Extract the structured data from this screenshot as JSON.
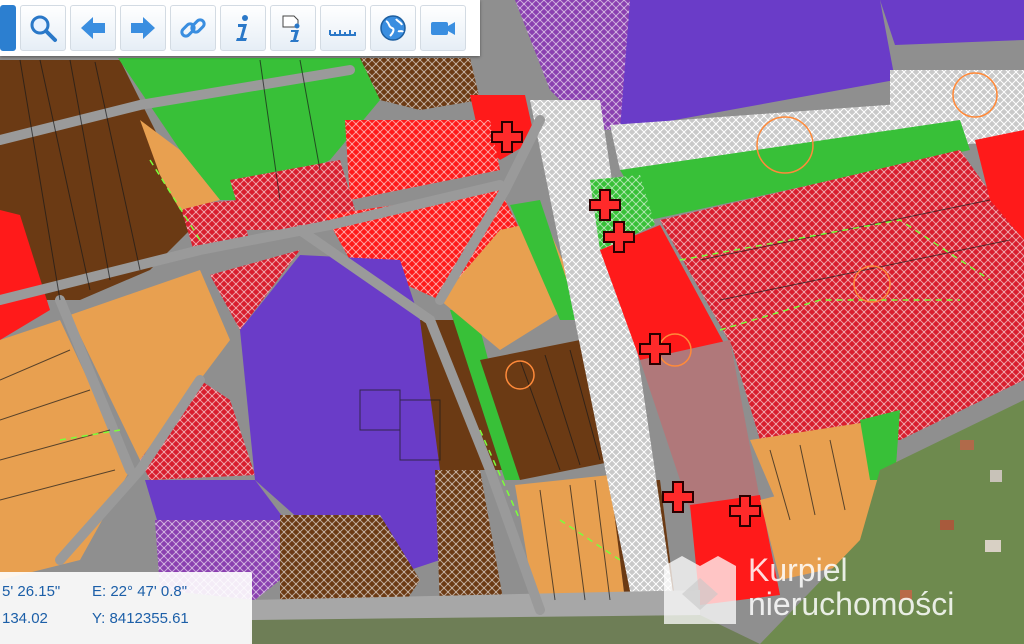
{
  "toolbar": {
    "tools": [
      {
        "name": "menu-tab",
        "icon": "menu-tab-icon"
      },
      {
        "name": "zoom",
        "icon": "magnifier-icon"
      },
      {
        "name": "back",
        "icon": "arrow-left-icon"
      },
      {
        "name": "forward",
        "icon": "arrow-right-icon"
      },
      {
        "name": "link",
        "icon": "chain-link-icon"
      },
      {
        "name": "info",
        "icon": "info-icon"
      },
      {
        "name": "info-document",
        "icon": "document-info-icon"
      },
      {
        "name": "measure",
        "icon": "ruler-icon"
      },
      {
        "name": "globe",
        "icon": "globe-icon"
      },
      {
        "name": "video",
        "icon": "video-camera-icon"
      }
    ]
  },
  "coordinates": {
    "lat_partial": "5' 26.15\"",
    "lon": "E:  22° 47' 0.8\"",
    "x_partial": "134.02",
    "y": "Y:  8412355.61"
  },
  "watermark": {
    "line1": "Kurpiel",
    "line2": "nieruchomości"
  },
  "legend_colors": {
    "residential_single": "#e8a050",
    "residential_multi": "#6b3a14",
    "commercial": "#ff1a1a",
    "services": "#d81e2e",
    "green": "#38c038",
    "public": "#6a3cc8",
    "roads": "#9a9a9a",
    "special": "#b0787a"
  }
}
